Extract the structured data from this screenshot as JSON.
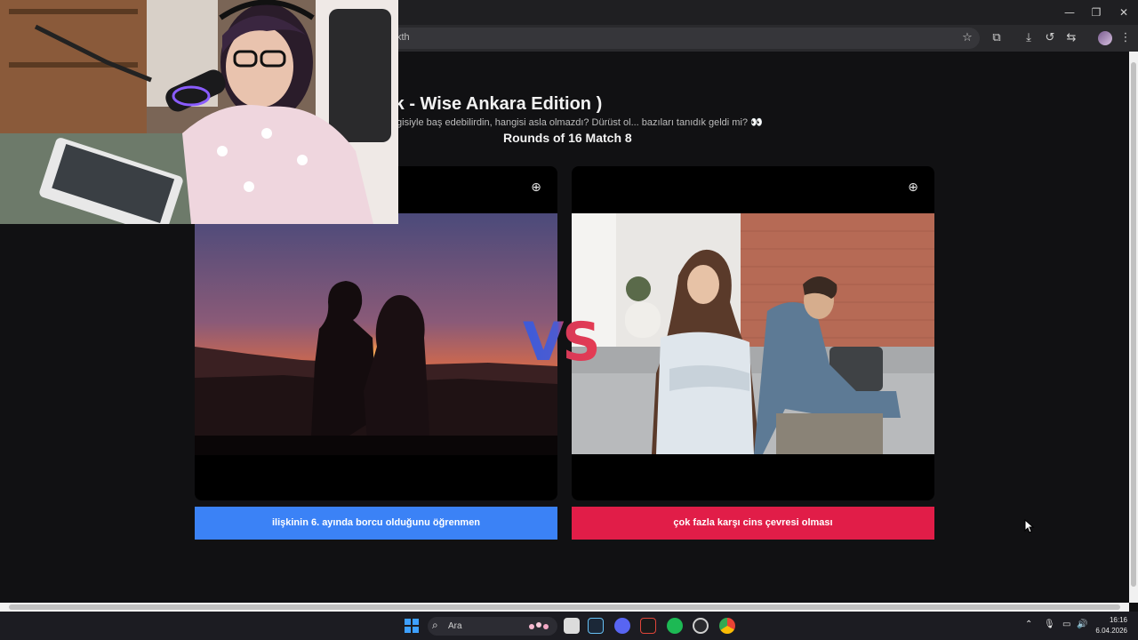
{
  "browser": {
    "url_fragment": "kth",
    "window_controls": {
      "minimize": "—",
      "restore": "❐",
      "close": "✕"
    },
    "toolbar_icons": [
      "star-icon",
      "extensions-icon",
      "download-icon",
      "history-icon",
      "translate-icon",
      "profile-avatar",
      "menu-icon"
    ]
  },
  "page": {
    "title": "ag Uwufusu ( Date O'Clock - Wise Ankara Edition )",
    "subtitle": "şer\" olanı seçmek zorundasın. İki kötü huydan hangisiyle baş edebilirdin, hangisi asla olmazdı? Dürüst ol... bazıları tanıdık geldi mi? 👀",
    "round_label": "Rounds of 16 Match 8",
    "vs_text": "VS",
    "left_option": {
      "label": "ilişkinin 6. ayında borcu olduğunu öğrenmen",
      "color": "#3b82f6",
      "zoom_icon": "zoom-in-icon"
    },
    "right_option": {
      "label": "çok fazla karşı cins çevresi olması",
      "color": "#e11d48",
      "zoom_icon": "zoom-in-icon"
    }
  },
  "taskbar": {
    "search_placeholder": "Ara",
    "time": "16:16",
    "date": "6.04.2026",
    "apps": [
      "file-explorer-icon",
      "steam-icon",
      "discord-icon",
      "app-icon",
      "spotify-icon",
      "app-icon",
      "chrome-icon"
    ]
  }
}
